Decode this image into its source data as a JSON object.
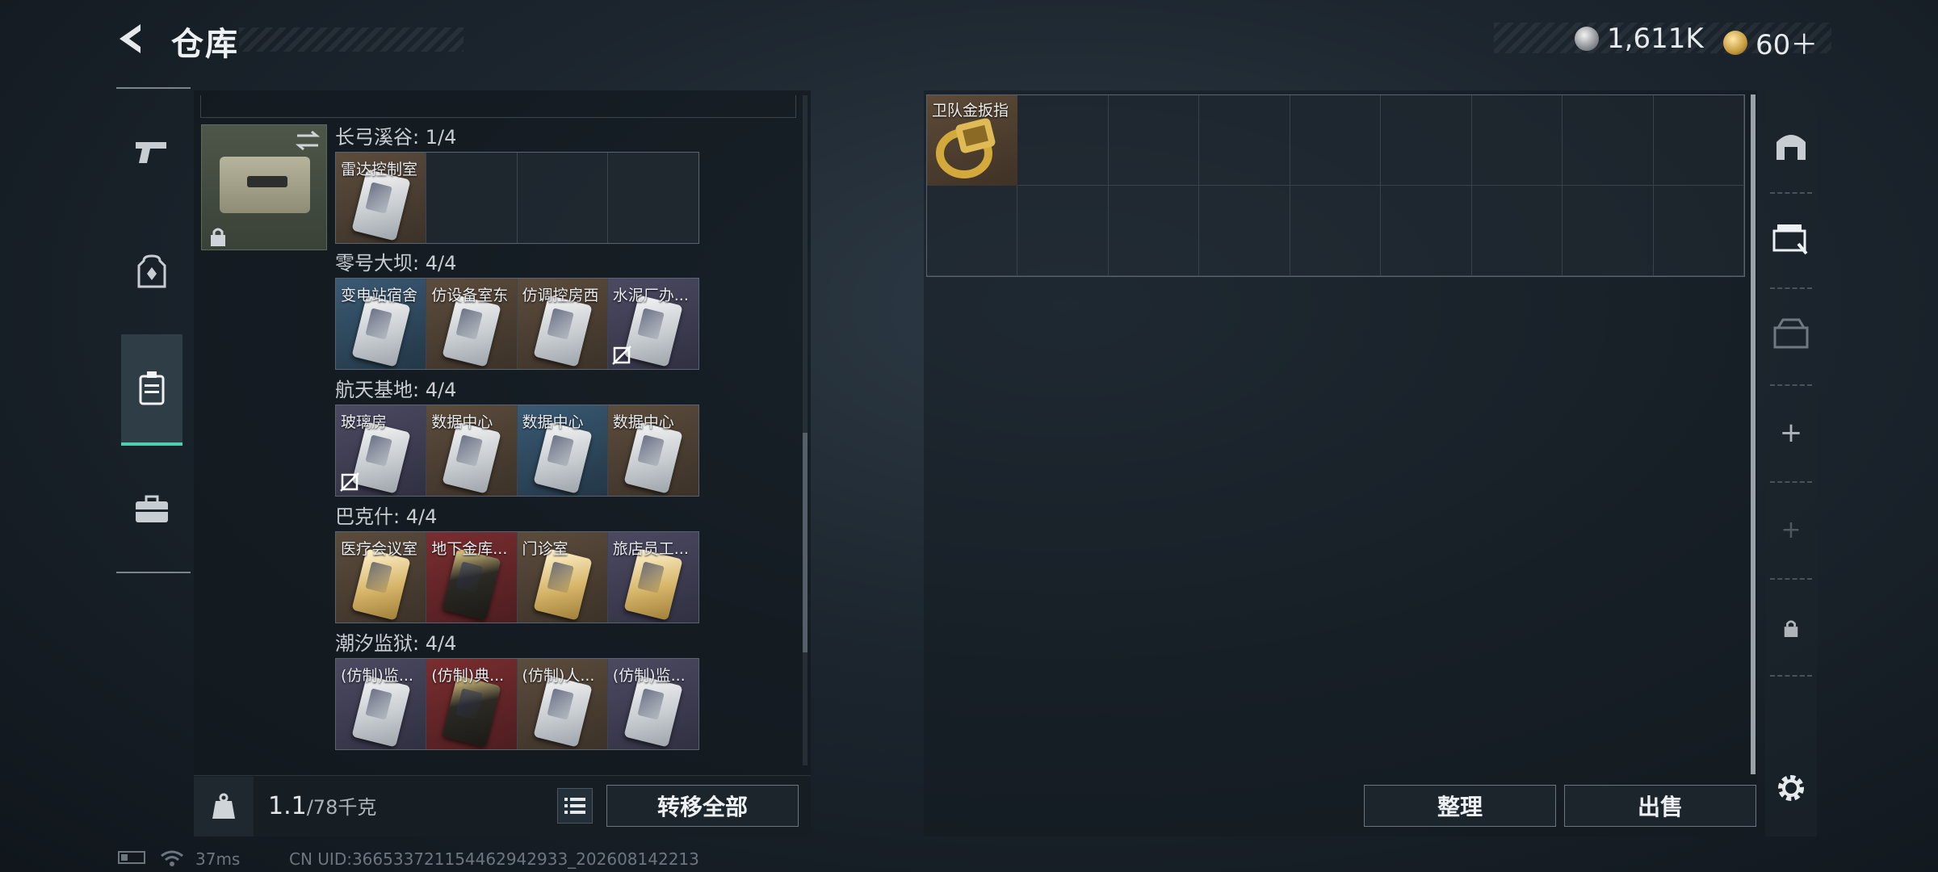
{
  "header": {
    "title": "仓库"
  },
  "currency": {
    "silver": "1,611K",
    "tokens": "60＋"
  },
  "case": {
    "groups": [
      {
        "label": "长弓溪谷: 1/4",
        "slots": [
          {
            "name": "雷达控制室",
            "bg": "brown",
            "card": "silver"
          },
          {
            "name": "",
            "bg": "empty"
          },
          {
            "name": "",
            "bg": "empty"
          },
          {
            "name": "",
            "bg": "empty"
          }
        ]
      },
      {
        "label": "零号大坝: 4/4",
        "slots": [
          {
            "name": "变电站宿舍",
            "bg": "blue",
            "card": "silver"
          },
          {
            "name": "仿设备室东",
            "bg": "brown",
            "card": "silver"
          },
          {
            "name": "仿调控房西",
            "bg": "brown",
            "card": "silver"
          },
          {
            "name": "水泥厂办...",
            "bg": "purple",
            "card": "silver",
            "nodrop": true
          }
        ]
      },
      {
        "label": "航天基地: 4/4",
        "slots": [
          {
            "name": "玻璃房",
            "bg": "purple",
            "card": "silver",
            "nodrop": true
          },
          {
            "name": "数据中心",
            "bg": "brown",
            "card": "silver"
          },
          {
            "name": "数据中心",
            "bg": "blue",
            "card": "silver"
          },
          {
            "name": "数据中心",
            "bg": "brown",
            "card": "silver"
          }
        ]
      },
      {
        "label": "巴克什: 4/4",
        "slots": [
          {
            "name": "医疗会议室",
            "bg": "brown",
            "card": "gold"
          },
          {
            "name": "地下金库...",
            "bg": "red",
            "card": "dark"
          },
          {
            "name": "门诊室",
            "bg": "brown",
            "card": "gold"
          },
          {
            "name": "旅店员工...",
            "bg": "purple",
            "card": "gold"
          }
        ]
      },
      {
        "label": "潮汐监狱: 4/4",
        "slots": [
          {
            "name": "(仿制)监...",
            "bg": "purple",
            "card": "silver"
          },
          {
            "name": "(仿制)典...",
            "bg": "red",
            "card": "dark"
          },
          {
            "name": "(仿制)人...",
            "bg": "brown",
            "card": "silver"
          },
          {
            "name": "(仿制)监...",
            "bg": "purple",
            "card": "silver"
          }
        ]
      }
    ]
  },
  "footer": {
    "weight_current": "1.1",
    "weight_max": "/78千克",
    "transfer_all": "转移全部"
  },
  "stash": {
    "item_name": "卫队金扳指"
  },
  "actions": {
    "sort": "整理",
    "sell": "出售"
  },
  "status": {
    "ping": "37ms",
    "uid": "CN UID:366533721154462942933_202608142213"
  },
  "colors": {
    "accent": "#4fd0b2"
  }
}
